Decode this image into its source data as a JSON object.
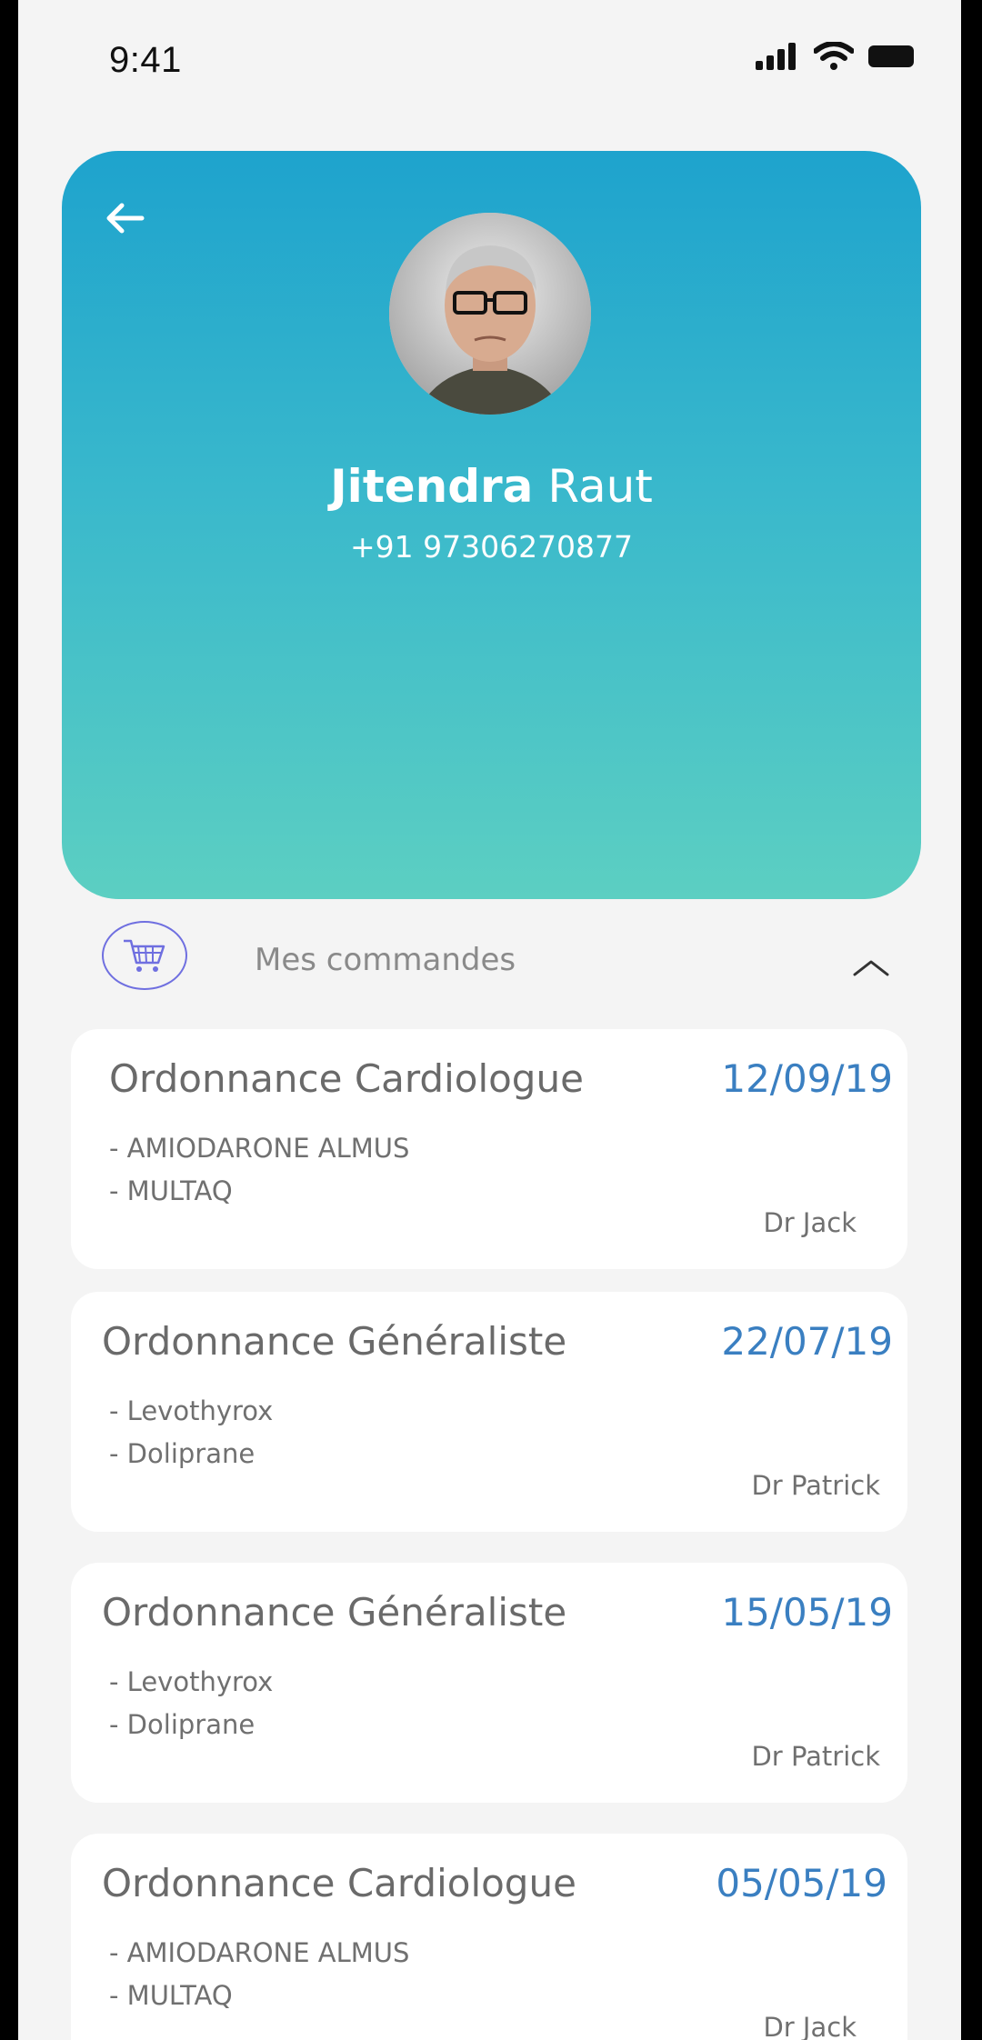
{
  "status_bar": {
    "time": "9:41"
  },
  "profile": {
    "first_name": "Jitendra",
    "last_name": "Raut",
    "phone": "+91 97306270877"
  },
  "section": {
    "title": "Mes commandes"
  },
  "orders": [
    {
      "title": "Ordonnance Cardiologue",
      "date": "12/09/19",
      "meds": [
        "- AMIODARONE ALMUS",
        "- MULTAQ"
      ],
      "doctor": "Dr Jack"
    },
    {
      "title": "Ordonnance Généraliste",
      "date": "22/07/19",
      "meds": [
        "- Levothyrox",
        "- Doliprane"
      ],
      "doctor": "Dr Patrick"
    },
    {
      "title": "Ordonnance Généraliste",
      "date": "15/05/19",
      "meds": [
        "- Levothyrox",
        "- Doliprane"
      ],
      "doctor": "Dr Patrick"
    },
    {
      "title": "Ordonnance Cardiologue",
      "date": "05/05/19",
      "meds": [
        "- AMIODARONE ALMUS",
        "- MULTAQ"
      ],
      "doctor": "Dr Jack"
    }
  ],
  "colors": {
    "header_gradient_top": "#1ea3cd",
    "header_gradient_bottom": "#5ccfc2",
    "date_accent": "#3a7fc1",
    "cart_accent": "#6f6fe0"
  },
  "icons": {
    "back": "arrow-left-icon",
    "cart": "shopping-cart-icon",
    "collapse": "chevron-up-icon"
  }
}
